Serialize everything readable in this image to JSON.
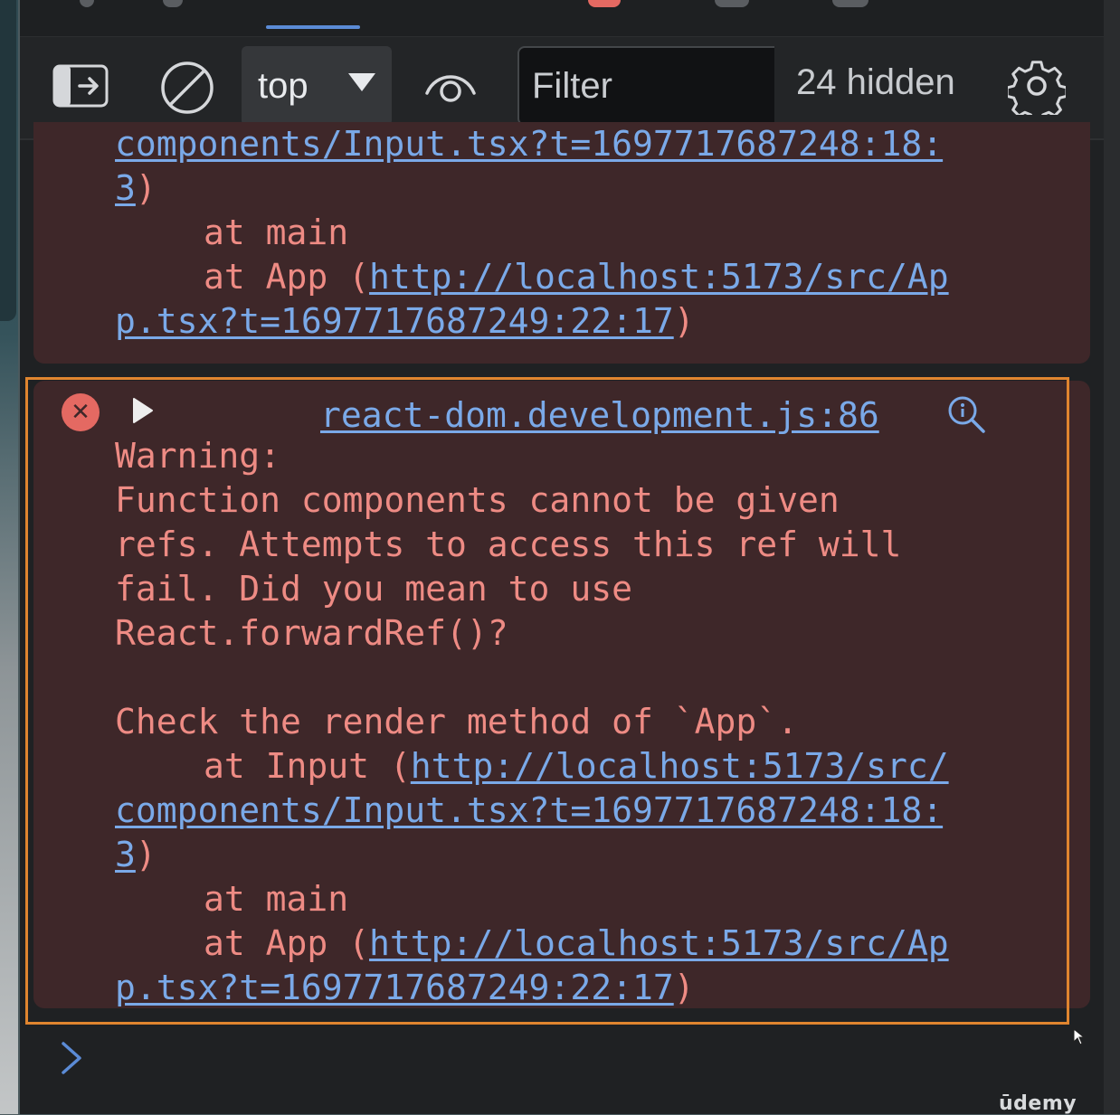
{
  "toolbar": {
    "context_value": "top",
    "filter_placeholder": "Filter",
    "hidden_count": "24 hidden"
  },
  "console": {
    "previous_message": {
      "lines": [
        {
          "indent": false,
          "prefix": "",
          "link": "components/Input.tsx?t=1697717687248:18:",
          "suffix": ""
        },
        {
          "indent": false,
          "prefix": "",
          "link": "3",
          "suffix": ")"
        },
        {
          "indent": true,
          "prefix": "at main",
          "link": "",
          "suffix": ""
        },
        {
          "indent": true,
          "prefix": "at App (",
          "link": "http://localhost:5173/src/Ap",
          "suffix": ""
        },
        {
          "indent": false,
          "prefix": "",
          "link": "p.tsx?t=1697717687249:22:17",
          "suffix": ")"
        }
      ]
    },
    "current_message": {
      "source": "react-dom.development.js:86",
      "lines": [
        {
          "indent": false,
          "prefix": "Warning:",
          "link": "",
          "suffix": ""
        },
        {
          "indent": false,
          "prefix": "Function components cannot be given",
          "link": "",
          "suffix": ""
        },
        {
          "indent": false,
          "prefix": "refs. Attempts to access this ref will",
          "link": "",
          "suffix": ""
        },
        {
          "indent": false,
          "prefix": "fail. Did you mean to use",
          "link": "",
          "suffix": ""
        },
        {
          "indent": false,
          "prefix": "React.forwardRef()?",
          "link": "",
          "suffix": ""
        },
        {
          "indent": false,
          "prefix": "",
          "link": "",
          "suffix": ""
        },
        {
          "indent": false,
          "prefix": "Check the render method of `App`.",
          "link": "",
          "suffix": ""
        },
        {
          "indent": true,
          "prefix": "at Input (",
          "link": "http://localhost:5173/src/",
          "suffix": ""
        },
        {
          "indent": false,
          "prefix": "",
          "link": "components/Input.tsx?t=1697717687248:18:",
          "suffix": ""
        },
        {
          "indent": false,
          "prefix": "",
          "link": "3",
          "suffix": ")"
        },
        {
          "indent": true,
          "prefix": "at main",
          "link": "",
          "suffix": ""
        },
        {
          "indent": true,
          "prefix": "at App (",
          "link": "http://localhost:5173/src/Ap",
          "suffix": ""
        },
        {
          "indent": false,
          "prefix": "",
          "link": "p.tsx?t=1697717687249:22:17",
          "suffix": ")"
        }
      ]
    }
  },
  "watermark": "ūdemy",
  "colors": {
    "error_text": "#ee8b84",
    "link": "#7aa9e8",
    "error_bg": "#3e2729",
    "highlight": "#e0852f"
  }
}
